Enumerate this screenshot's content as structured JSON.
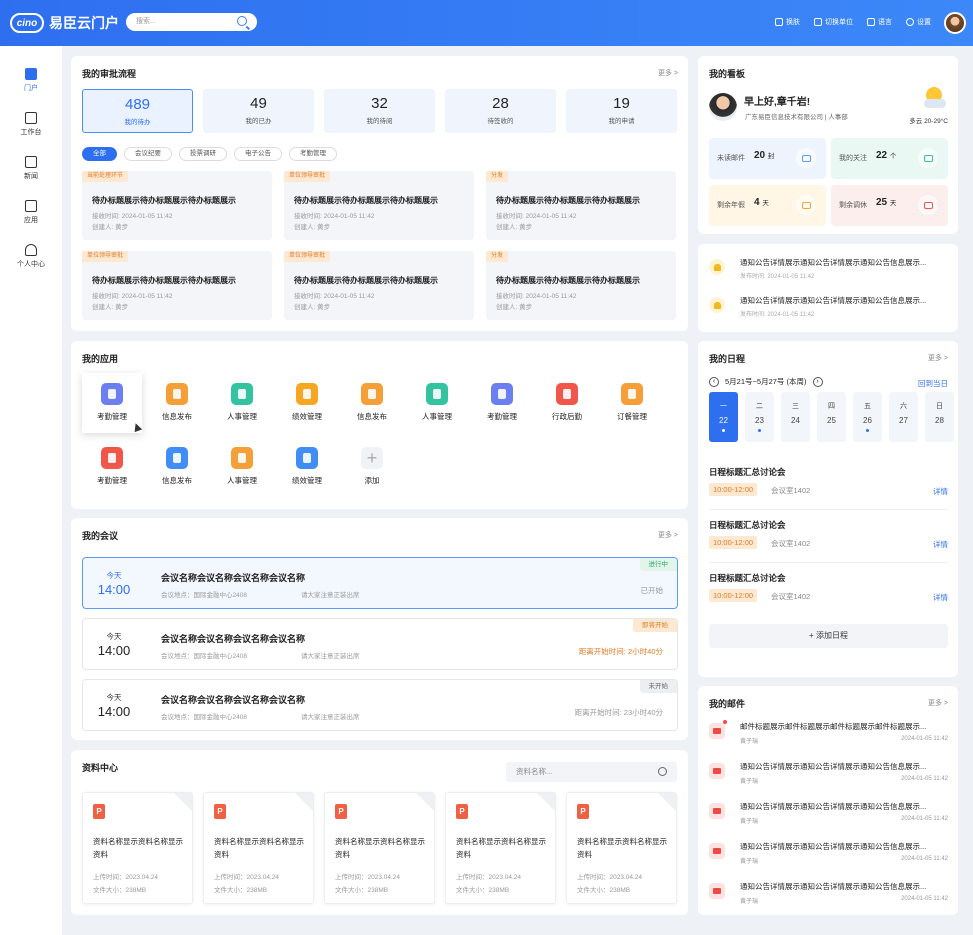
{
  "header": {
    "logo_mark": "cino",
    "app_name": "易臣云门户",
    "search_placeholder": "搜索...",
    "menu": [
      "换肤",
      "切换单位",
      "语言",
      "设置"
    ]
  },
  "sidebar": [
    {
      "label": "门户",
      "active": true
    },
    {
      "label": "工作台"
    },
    {
      "label": "新闻"
    },
    {
      "label": "应用"
    },
    {
      "label": "个人中心"
    }
  ],
  "approval": {
    "title": "我的审批流程",
    "more": "更多 >",
    "stats": [
      {
        "n": "489",
        "l": "我的待办",
        "active": true
      },
      {
        "n": "49",
        "l": "我的已办"
      },
      {
        "n": "32",
        "l": "我的待阅"
      },
      {
        "n": "28",
        "l": "待签收的"
      },
      {
        "n": "19",
        "l": "我的申请"
      }
    ],
    "filters": [
      "全部",
      "会议纪要",
      "投票调研",
      "电子公告",
      "考勤管理"
    ],
    "tasks": [
      {
        "tag": "当前处理环节",
        "title": "待办标题展示待办标题展示待办标题展示",
        "recv": "接收时间: 2024-01-05 11:42",
        "creator": "创建人: 黄步"
      },
      {
        "tag": "单位领导审批",
        "title": "待办标题展示待办标题展示待办标题展示",
        "recv": "接收时间: 2024-01-05 11:42",
        "creator": "创建人: 黄步"
      },
      {
        "tag": "分发",
        "title": "待办标题展示待办标题展示待办标题展示",
        "recv": "接收时间: 2024-01-05 11:42",
        "creator": "创建人: 黄步"
      },
      {
        "tag": "单位领导审批",
        "title": "待办标题展示待办标题展示待办标题展示",
        "recv": "接收时间: 2024-01-05 11:42",
        "creator": "创建人: 黄步"
      },
      {
        "tag": "单位领导审批",
        "title": "待办标题展示待办标题展示待办标题展示",
        "recv": "接收时间: 2024-01-05 11:42",
        "creator": "创建人: 黄步"
      },
      {
        "tag": "分发",
        "title": "待办标题展示待办标题展示待办标题展示",
        "recv": "接收时间: 2024-01-05 11:42",
        "creator": "创建人: 黄步"
      }
    ]
  },
  "apps": {
    "title": "我的应用",
    "items": [
      {
        "label": "考勤管理",
        "color": "#6b7ff0"
      },
      {
        "label": "信息发布",
        "color": "#f59f38"
      },
      {
        "label": "人事管理",
        "color": "#34c3a0"
      },
      {
        "label": "绩效管理",
        "color": "#f5a623"
      },
      {
        "label": "信息发布",
        "color": "#f59f38"
      },
      {
        "label": "人事管理",
        "color": "#34c3a0"
      },
      {
        "label": "考勤管理",
        "color": "#6b7ff0"
      },
      {
        "label": "行政后勤",
        "color": "#f0574a"
      },
      {
        "label": "订餐管理",
        "color": "#f59f38"
      },
      {
        "label": "考勤管理",
        "color": "#f0574a"
      },
      {
        "label": "信息发布",
        "color": "#3f8df5"
      },
      {
        "label": "人事管理",
        "color": "#f59f38"
      },
      {
        "label": "绩效管理",
        "color": "#3f8df5"
      },
      {
        "label": "添加",
        "color": "#f0f2f5"
      }
    ]
  },
  "meetings": {
    "title": "我的会议",
    "more": "更多 >",
    "items": [
      {
        "day": "今天",
        "time": "14:00",
        "title": "会议名称会议名称会议名称会议名称",
        "loc": "会议地点：国际金融中心2408",
        "note": "请大家注意正装出席",
        "badge": "进行中",
        "badge_color": "#2aa86a",
        "badge_bg": "#e3f5ea",
        "right": "已开始",
        "active": true
      },
      {
        "day": "今天",
        "time": "14:00",
        "title": "会议名称会议名称会议名称会议名称",
        "loc": "会议地点：国际金融中心2408",
        "note": "请大家注意正装出席",
        "badge": "即将开始",
        "badge_color": "#e07b26",
        "badge_bg": "#fde8d2",
        "right": "距离开始时间: 2小时40分"
      },
      {
        "day": "今天",
        "time": "14:00",
        "title": "会议名称会议名称会议名称会议名称",
        "loc": "会议地点：国际金融中心2408",
        "note": "请大家注意正装出席",
        "badge": "未开始",
        "badge_color": "#666",
        "badge_bg": "#eceef1",
        "right": "距离开始时间: 23小时40分"
      }
    ]
  },
  "docs": {
    "title": "资料中心",
    "search_placeholder": "资料名称...",
    "items": [
      {
        "title": "资料名称显示资料名称显示资料",
        "uploaded": "上传时间：2023.04.24",
        "size": "文件大小：238MB"
      },
      {
        "title": "资料名称显示资料名称显示资料",
        "uploaded": "上传时间：2023.04.24",
        "size": "文件大小：238MB"
      },
      {
        "title": "资料名称显示资料名称显示资料",
        "uploaded": "上传时间：2023.04.24",
        "size": "文件大小：238MB"
      },
      {
        "title": "资料名称显示资料名称显示资料",
        "uploaded": "上传时间：2023.04.24",
        "size": "文件大小：238MB"
      },
      {
        "title": "资料名称显示资料名称显示资料",
        "uploaded": "上传时间：2023.04.24",
        "size": "文件大小：238MB"
      }
    ]
  },
  "board": {
    "title": "我的看板",
    "greeting": "早上好,章千岩!",
    "company": "广东易臣信息技术有限公司 | 人事部",
    "weather": "多云 20-29°C",
    "kv": [
      {
        "label": "未读邮件",
        "value": "20",
        "unit": "封",
        "bg": "#eef4fd",
        "ic": "#5b9bf5"
      },
      {
        "label": "我的关注",
        "value": "22",
        "unit": "个",
        "bg": "#eaf8f3",
        "ic": "#34c3a0"
      },
      {
        "label": "剩余年假",
        "value": "4",
        "unit": "天",
        "bg": "#fff6e6",
        "ic": "#f5a623"
      },
      {
        "label": "剩余调休",
        "value": "25",
        "unit": "天",
        "bg": "#fdeeee",
        "ic": "#f0574a"
      }
    ]
  },
  "notices": [
    {
      "title": "通知公告详情展示通知公告详情展示通知公告信息展示...",
      "time": "发布时间: 2024-01-05 11:42"
    },
    {
      "title": "通知公告详情展示通知公告详情展示通知公告信息展示...",
      "time": "发布时间: 2024-01-05 11:42"
    }
  ],
  "schedule": {
    "title": "我的日程",
    "more": "更多 >",
    "range": "5月21号~5月27号 (本周)",
    "today_btn": "回到当日",
    "days": [
      {
        "w": "一",
        "d": "22",
        "dot": true,
        "active": true
      },
      {
        "w": "二",
        "d": "23",
        "dot": true
      },
      {
        "w": "三",
        "d": "24"
      },
      {
        "w": "四",
        "d": "25"
      },
      {
        "w": "五",
        "d": "26",
        "dot": true
      },
      {
        "w": "六",
        "d": "27"
      },
      {
        "w": "日",
        "d": "28"
      }
    ],
    "events": [
      {
        "title": "日程标题汇总讨论会",
        "time": "10:00-12:00",
        "room": "会议室1402",
        "detail": "详情"
      },
      {
        "title": "日程标题汇总讨论会",
        "time": "10:00-12:00",
        "room": "会议室1402",
        "detail": "详情"
      },
      {
        "title": "日程标题汇总讨论会",
        "time": "10:00-12:00",
        "room": "会议室1402",
        "detail": "详情"
      }
    ],
    "add": "+ 添加日程"
  },
  "mail": {
    "title": "我的邮件",
    "more": "更多 >",
    "items": [
      {
        "title": "邮件标题展示邮件标题展示邮件标题展示邮件标题展示...",
        "from": "黄子瑞",
        "date": "2024-01-05 11:42",
        "unread": true
      },
      {
        "title": "通知公告详情展示通知公告详情展示通知公告信息展示...",
        "from": "黄子瑞",
        "date": "2024-01-05 11:42"
      },
      {
        "title": "通知公告详情展示通知公告详情展示通知公告信息展示...",
        "from": "黄子瑞",
        "date": "2024-01-05 11:42"
      },
      {
        "title": "通知公告详情展示通知公告详情展示通知公告信息展示...",
        "from": "黄子瑞",
        "date": "2024-01-05 11:42"
      },
      {
        "title": "通知公告详情展示通知公告详情展示通知公告信息展示...",
        "from": "黄子瑞",
        "date": "2024-01-05 11:42"
      }
    ]
  }
}
